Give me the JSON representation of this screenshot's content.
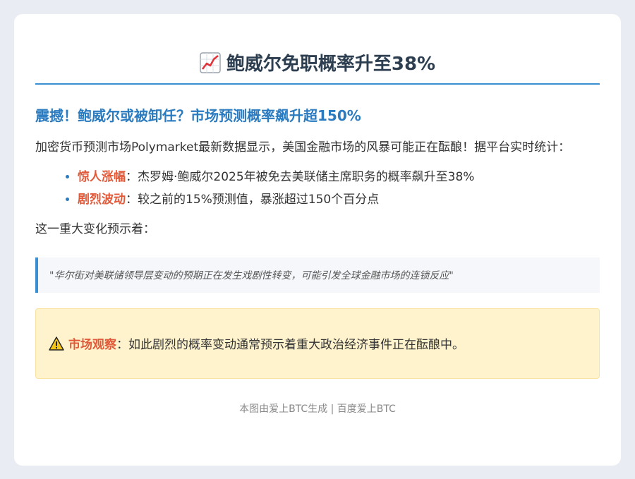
{
  "card": {
    "title": "鲍威尔免职概率升至38%",
    "title_icon": "chart-increasing-icon",
    "headline": "震撼！鲍威尔或被卸任？市场预测概率飙升超150%",
    "intro": "加密货币预测市场Polymarket最新数据显示，美国金融市场的风暴可能正在酝酿！据平台实时统计：",
    "bullets": [
      {
        "label": "惊人涨幅",
        "text": "：杰罗姆·鲍威尔2025年被免去美联储主席职务的概率飙升至38%"
      },
      {
        "label": "剧烈波动",
        "text": "：较之前的15%预测值，暴涨超过150个百分点"
      }
    ],
    "transition": "这一重大变化预示着：",
    "quote": "\"华尔街对美联储领导层变动的预期正在发生戏剧性转变，可能引发全球金融市场的连锁反应\"",
    "notice": {
      "icon": "warning-icon",
      "label": "市场观察",
      "text": "：如此剧烈的概率变动通常预示着重大政治经济事件正在酝酿中。"
    },
    "footer": "本图由爱上BTC生成 | 百度爱上BTC"
  },
  "colors": {
    "accent": "#3a8fd0",
    "headline": "#2a7bc0",
    "highlight": "#e05a3a",
    "notice_bg": "#fef3cd"
  }
}
